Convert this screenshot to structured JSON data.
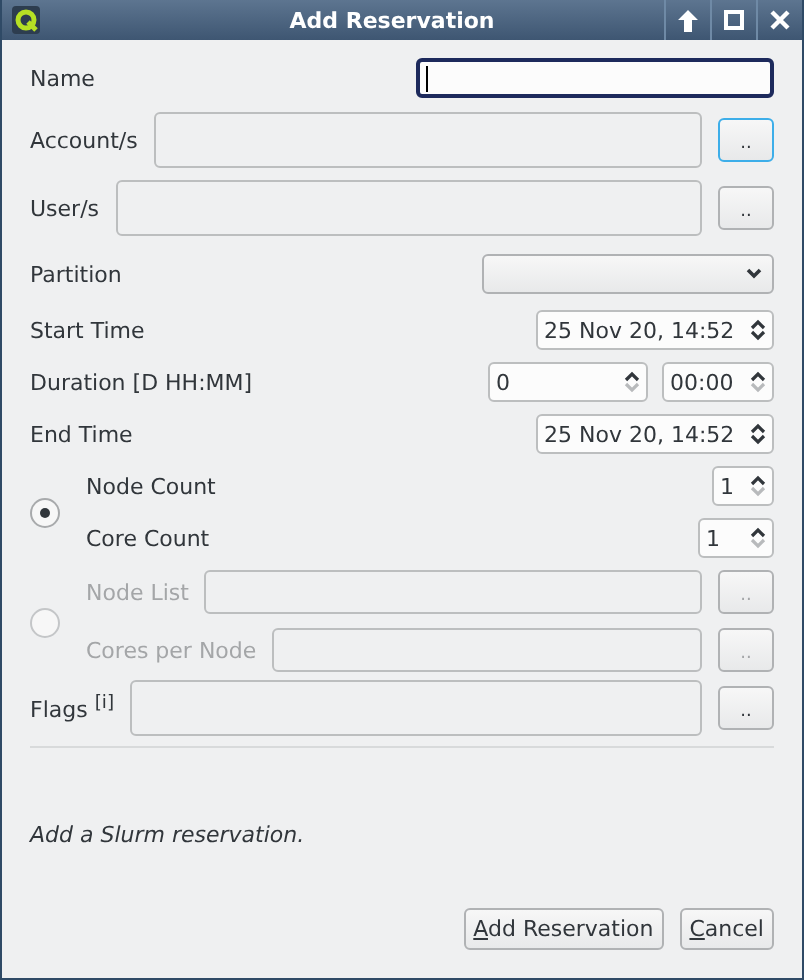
{
  "window": {
    "title": "Add Reservation"
  },
  "name": {
    "label": "Name",
    "focused": true
  },
  "accounts": {
    "label": "Account/s",
    "button": "..",
    "button_focused": true
  },
  "users": {
    "label": "User/s",
    "button": "..",
    "button_focused": false
  },
  "partition": {
    "label": "Partition"
  },
  "start_time": {
    "label": "Start Time",
    "value": "25 Nov 20, 14:52"
  },
  "duration": {
    "label": "Duration [D HH:MM]",
    "days": "0",
    "time": "00:00"
  },
  "end_time": {
    "label": "End Time",
    "value": "25 Nov 20, 14:52"
  },
  "reservation_modes": [
    {
      "selected": true,
      "disabled": false,
      "rows": [
        {
          "kind": "spin",
          "label": "Node Count",
          "value": "1"
        },
        {
          "kind": "spin",
          "label": "Core Count",
          "value": "1"
        }
      ]
    },
    {
      "selected": false,
      "disabled": true,
      "rows": [
        {
          "kind": "field",
          "label": "Node List",
          "button": ".."
        },
        {
          "kind": "field",
          "label": "Cores per Node",
          "button": ".."
        }
      ]
    }
  ],
  "flags": {
    "label": "Flags $^{[i]}$",
    "button": ".."
  },
  "description": "Add a Slurm reservation.",
  "buttons": [
    {
      "label": "Add Reservation"
    },
    {
      "label": "Cancel"
    }
  ]
}
